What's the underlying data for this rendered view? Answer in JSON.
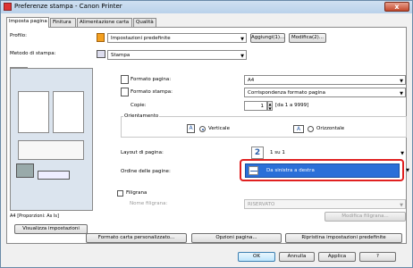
{
  "window": {
    "title": "Preferenze stampa - Canon Printer",
    "close": "x"
  },
  "tabs": [
    "Imposta pagina",
    "Finitura",
    "Alimentazione carta",
    "Qualità"
  ],
  "profile": {
    "label": "Profilo:",
    "value": "Impostazioni predefinite",
    "add": "Aggiungi(1)...",
    "edit": "Modifica(2)..."
  },
  "output": {
    "label": "Metodo di stampa:",
    "value": "Stampa"
  },
  "preview": {
    "caption": "A4 [Proporzioni: As Is]"
  },
  "page_size": {
    "label": "Formato pagina:",
    "value": "A4"
  },
  "output_size": {
    "label": "Formato stampa:",
    "value": "Corrispondenza formato pagina"
  },
  "copies": {
    "label": "Copie:",
    "value": "1",
    "range": "[da 1 a 9999]"
  },
  "orientation": {
    "label": "Orientamento",
    "portrait": "Verticale",
    "landscape": "Orizzontale",
    "selected": "portrait"
  },
  "layout": {
    "label": "Layout di pagina:",
    "value": "1 su 1",
    "icon_text": "2"
  },
  "page_order": {
    "label": "Ordine delle pagine:",
    "value": "Da sinistra a destra"
  },
  "watermark": {
    "label": "Filigrana",
    "name_label": "Nome filigrana:",
    "name_value": "RISERVATO",
    "edit": "Modifica filigrana..."
  },
  "view_settings": "Visualizza impostazioni",
  "bottom": {
    "custom_paper": "Formato carta personalizzato...",
    "page_options": "Opzioni pagina...",
    "restore": "Ripristina impostazioni predefinite"
  },
  "footer": {
    "ok": "OK",
    "cancel": "Annulla",
    "apply": "Applica",
    "help": "?"
  }
}
